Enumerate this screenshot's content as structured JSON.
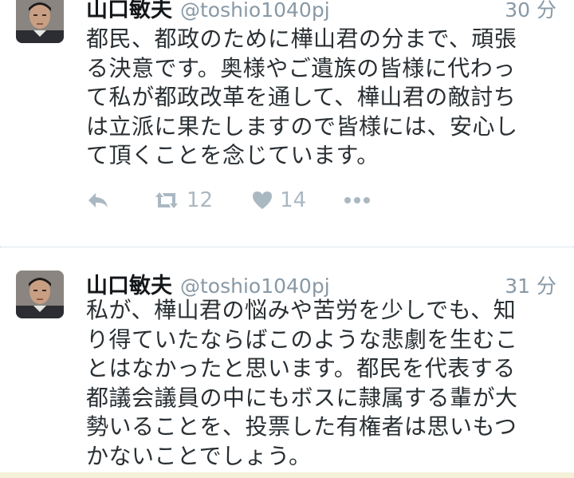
{
  "tweets": [
    {
      "name": "山口敏夫",
      "handle": "@toshio1040pj",
      "time": "30 分",
      "text": "都民、都政のために樺山君の分まで、頑張\nる決意です。奥様やご遺族の皆様に代わっ\nて私が都政改革を通して、樺山君の敵討ち\nは立派に果たしますので皆様には、安心し\nて頂くことを念じています。",
      "retweets": "12",
      "likes": "14"
    },
    {
      "name": "山口敏夫",
      "handle": "@toshio1040pj",
      "time": "31 分",
      "text": "私が、樺山君の悩みや苦労を少しでも、知\nり得ていたならばこのような悲劇を生むこ\nとはなかったと思います。都民を代表する\n都議会議員の中にもボスに隷属する輩が大\n勢いることを、投票した有権者は思いもつ\nかないことでしょう。"
    }
  ],
  "icons": {
    "reply": "reply-icon",
    "retweet": "retweet-icon",
    "like": "heart-icon",
    "more": "more-icon"
  },
  "colors": {
    "text": "#292f33",
    "muted": "#8899a6",
    "action": "#aab8c2",
    "divider": "#e1e8ed"
  }
}
